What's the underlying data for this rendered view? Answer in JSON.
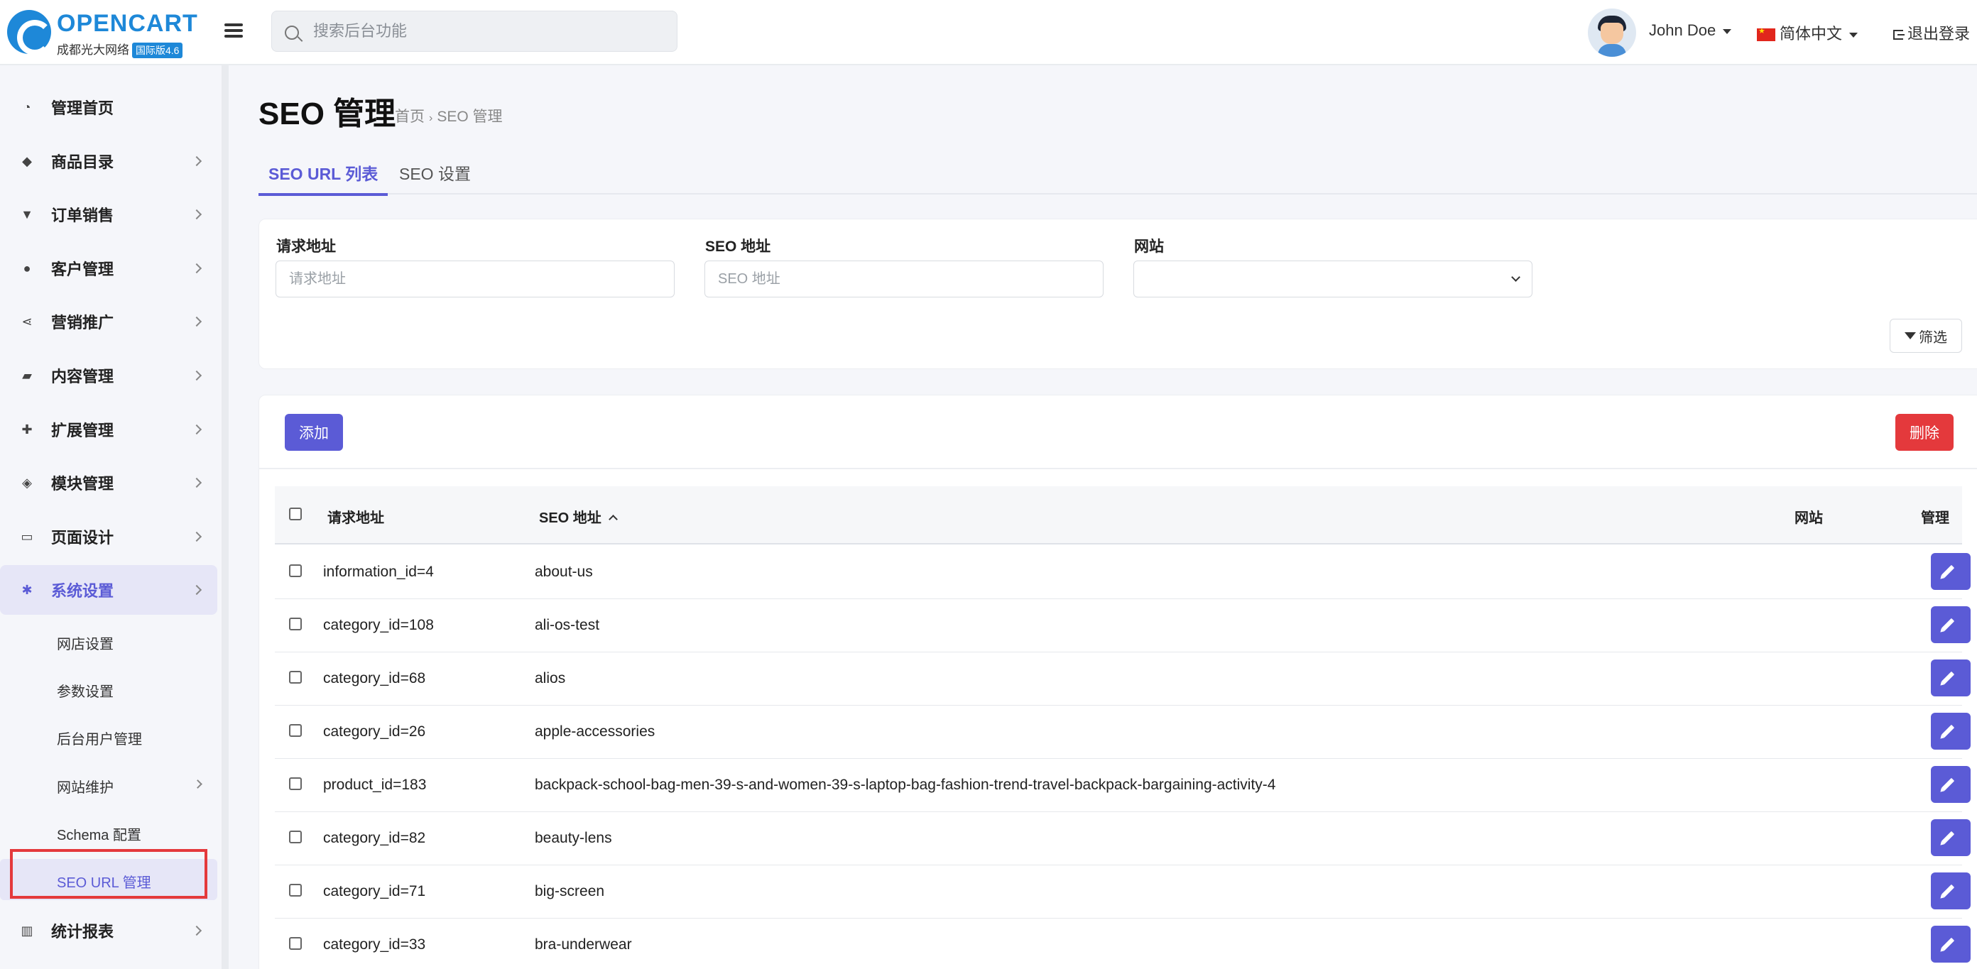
{
  "header": {
    "logo_name": "OPENCART",
    "logo_sub": "成都光大网络",
    "logo_badge": "国际版4.6",
    "search_placeholder": "搜索后台功能",
    "user_name": "John Doe",
    "language": "简体中文",
    "logout": "退出登录"
  },
  "sidebar": {
    "items": [
      {
        "label": "管理首页",
        "icon": "dashboard-icon"
      },
      {
        "label": "商品目录",
        "icon": "tags-icon"
      },
      {
        "label": "订单销售",
        "icon": "cart-icon"
      },
      {
        "label": "客户管理",
        "icon": "user-icon"
      },
      {
        "label": "营销推广",
        "icon": "share-icon"
      },
      {
        "label": "内容管理",
        "icon": "book-icon"
      },
      {
        "label": "扩展管理",
        "icon": "puzzle-icon"
      },
      {
        "label": "模块管理",
        "icon": "cube-icon"
      },
      {
        "label": "页面设计",
        "icon": "monitor-icon"
      },
      {
        "label": "系统设置",
        "icon": "gear-icon"
      },
      {
        "label": "统计报表",
        "icon": "bar-chart-icon"
      }
    ],
    "sub_items": [
      "网店设置",
      "参数设置",
      "后台用户管理",
      "网站维护",
      "Schema 配置",
      "SEO URL 管理"
    ]
  },
  "page": {
    "title": "SEO 管理",
    "breadcrumb_home": "首页",
    "breadcrumb_current": "SEO 管理",
    "tabs": [
      "SEO URL 列表",
      "SEO 设置"
    ]
  },
  "filter": {
    "keyword_label": "请求地址",
    "keyword_placeholder": "请求地址",
    "seo_label": "SEO 地址",
    "seo_placeholder": "SEO 地址",
    "store_label": "网站",
    "store_value": "",
    "filter_button": "筛选"
  },
  "list": {
    "add_button": "添加",
    "delete_button": "删除",
    "columns": [
      "请求地址",
      "SEO 地址",
      "网站",
      "管理"
    ],
    "sort_column": "SEO 地址",
    "sort_direction": "ascending",
    "rows": [
      {
        "key": "information_id=4",
        "keyword": "about-us",
        "store": ""
      },
      {
        "key": "category_id=108",
        "keyword": "ali-os-test",
        "store": ""
      },
      {
        "key": "category_id=68",
        "keyword": "alios",
        "store": ""
      },
      {
        "key": "category_id=26",
        "keyword": "apple-accessories",
        "store": ""
      },
      {
        "key": "product_id=183",
        "keyword": "backpack-school-bag-men-39-s-and-women-39-s-laptop-bag-fashion-trend-travel-backpack-bargaining-activity-4",
        "store": ""
      },
      {
        "key": "category_id=82",
        "keyword": "beauty-lens",
        "store": ""
      },
      {
        "key": "category_id=71",
        "keyword": "big-screen",
        "store": ""
      },
      {
        "key": "category_id=33",
        "keyword": "bra-underwear",
        "store": ""
      }
    ]
  },
  "colors": {
    "primary": "#5b5bd6",
    "danger": "#e4393c",
    "brand": "#1e88d8",
    "highlight_box": "#e4393c"
  }
}
